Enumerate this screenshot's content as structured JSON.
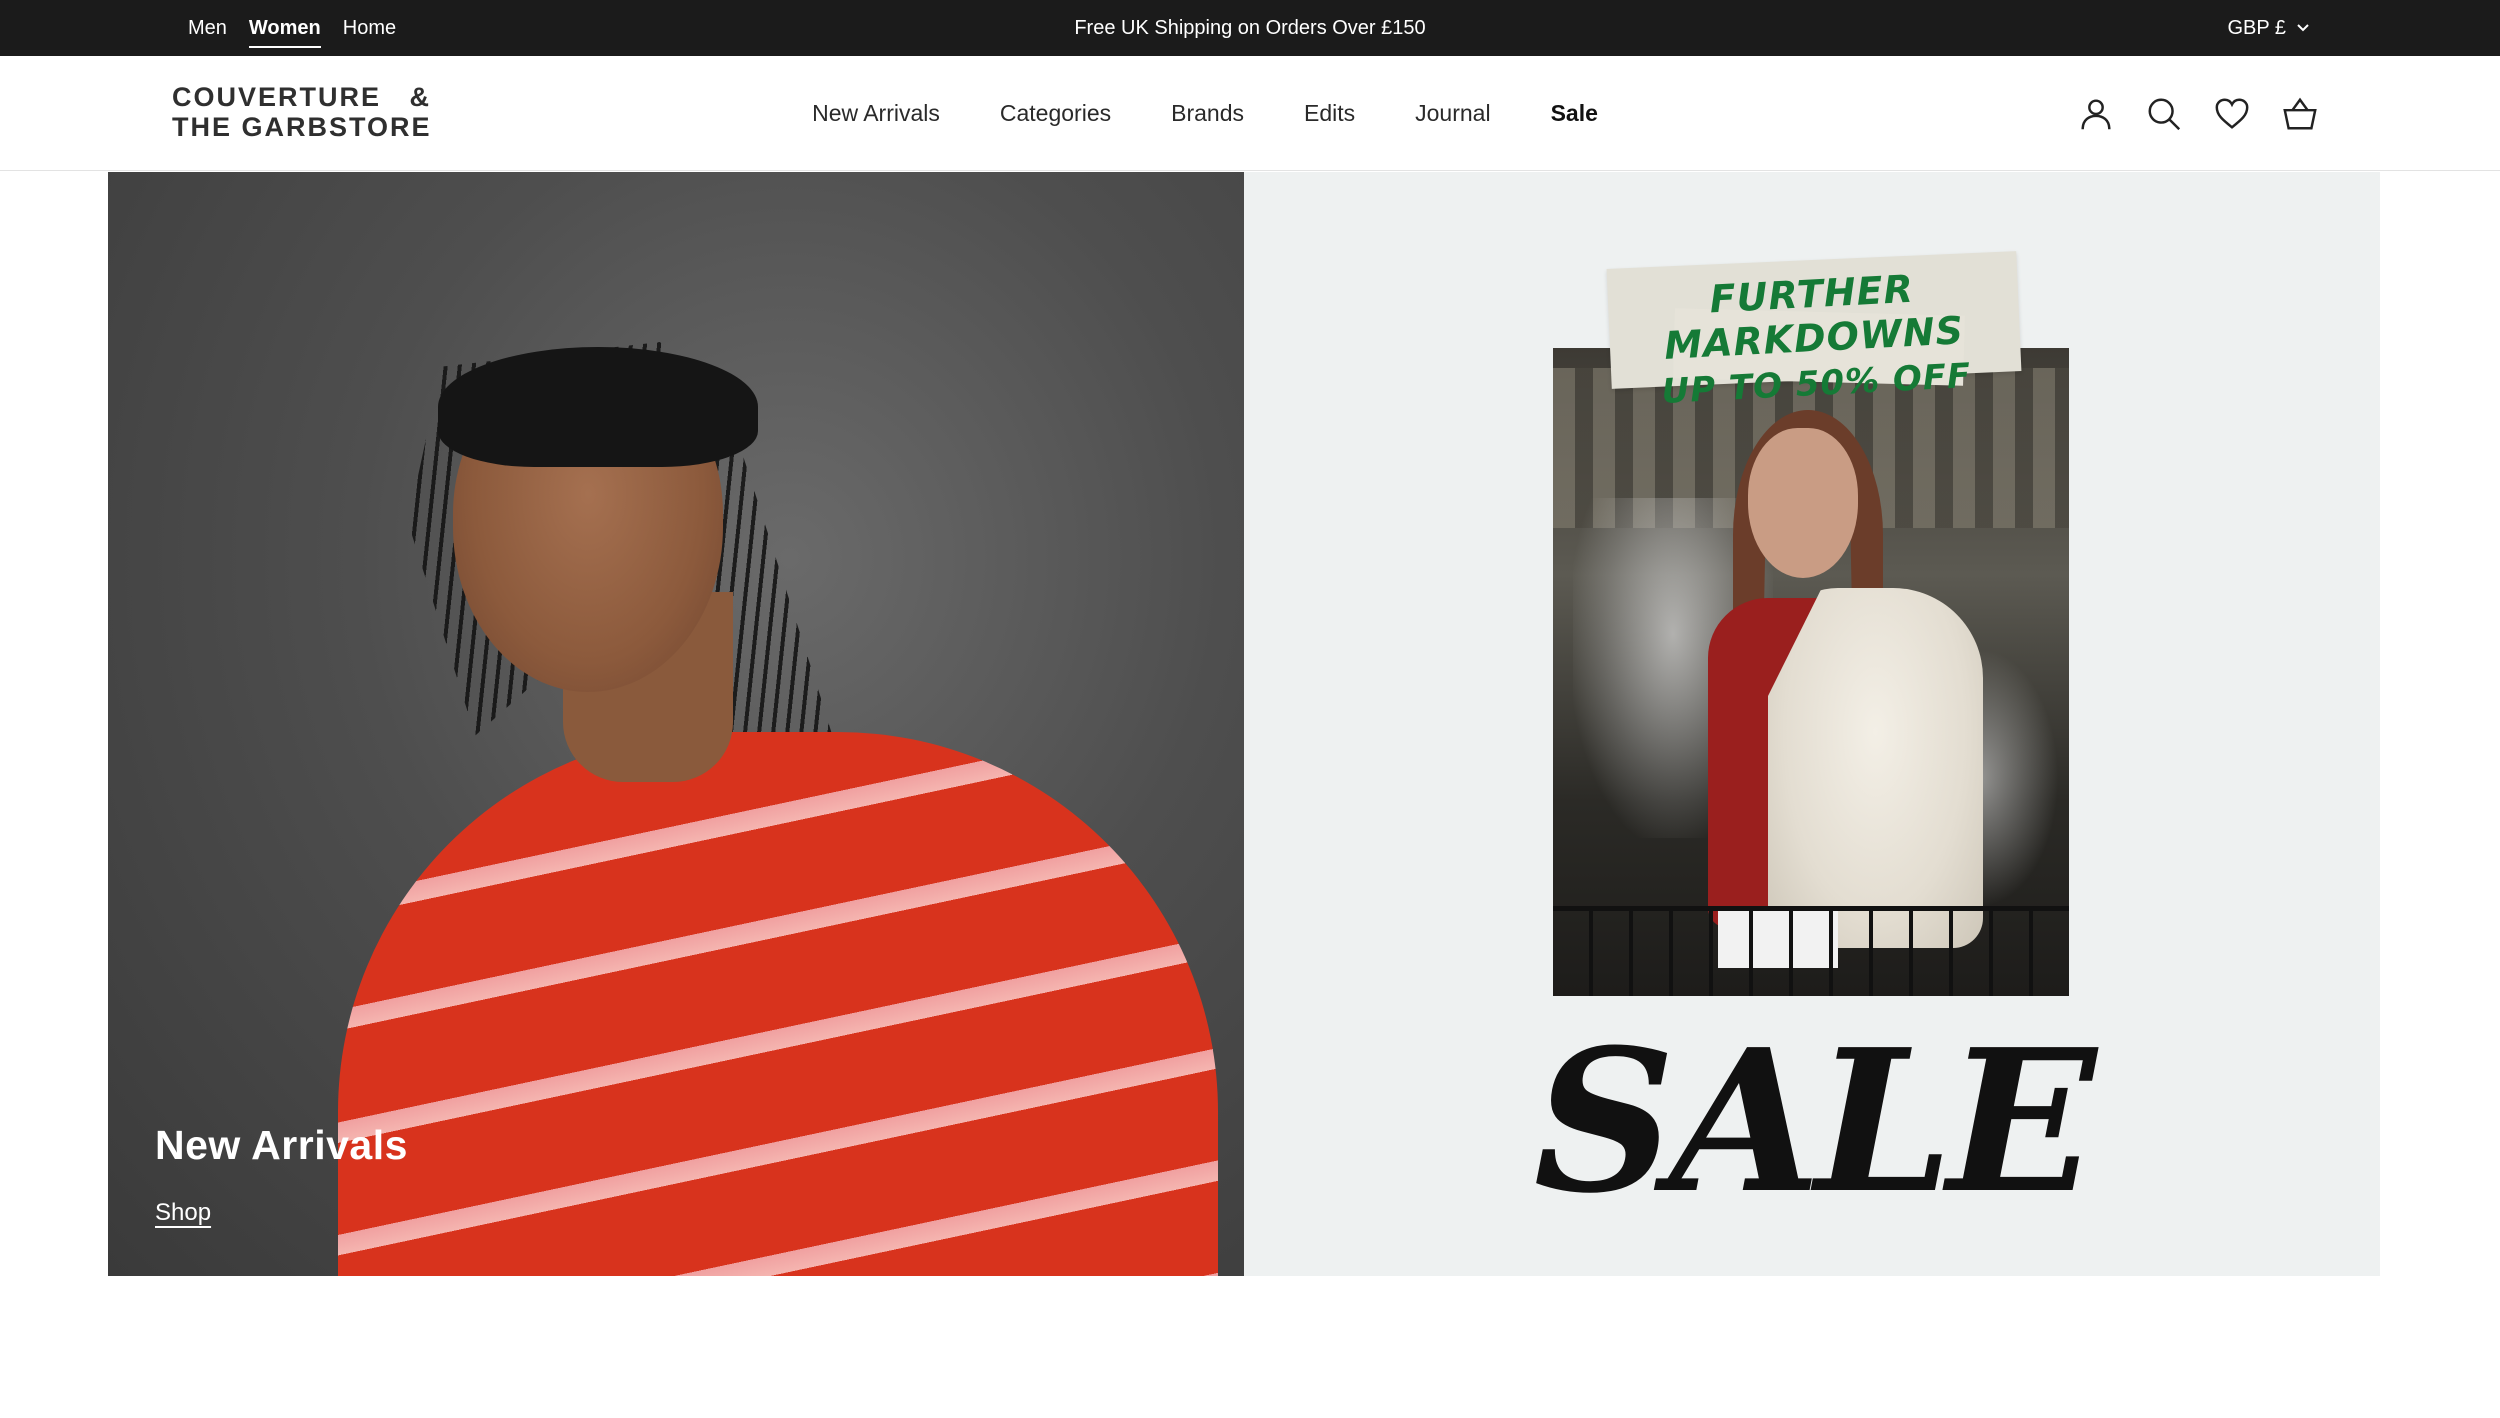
{
  "topbar": {
    "gender_links": [
      {
        "label": "Men",
        "active": false
      },
      {
        "label": "Women",
        "active": true
      },
      {
        "label": "Home",
        "active": false
      }
    ],
    "promo": "Free UK Shipping on Orders Over £150",
    "currency": "GBP £",
    "background": "#1b1b1b"
  },
  "header": {
    "logo": {
      "line1": "COUVERTURE   &",
      "line2": "THE GARBSTORE"
    },
    "nav": [
      {
        "label": "New Arrivals"
      },
      {
        "label": "Categories"
      },
      {
        "label": "Brands"
      },
      {
        "label": "Edits"
      },
      {
        "label": "Journal"
      },
      {
        "label": "Sale",
        "bold": true
      }
    ],
    "icons": [
      "account-icon",
      "search-icon",
      "wishlist-heart-icon",
      "basket-icon"
    ]
  },
  "hero": {
    "left": {
      "title": "New Arrivals",
      "link": "Shop"
    },
    "right": {
      "tape_line1": "FURTHER MARKDOWNS",
      "tape_line2": "UP TO 50% OFF",
      "headline": "SALE",
      "accent_color": "#157a36"
    }
  }
}
